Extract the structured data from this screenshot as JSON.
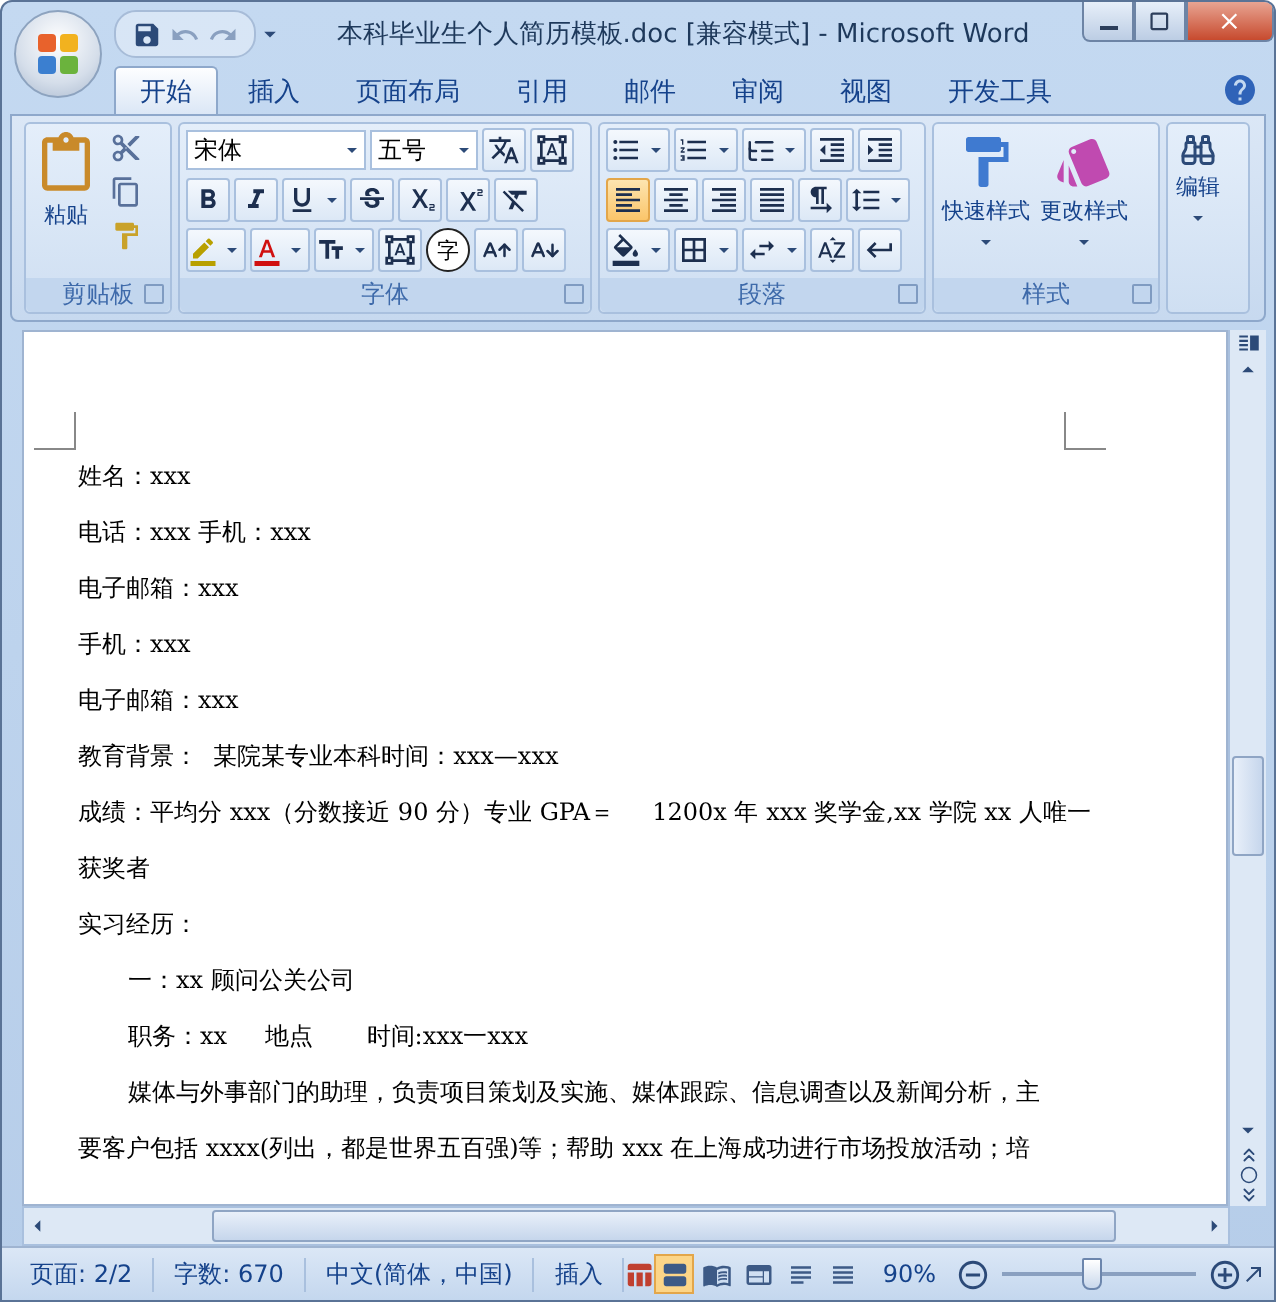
{
  "window": {
    "title": "本科毕业生个人简历模板.doc [兼容模式] - Microsoft Word"
  },
  "tabs": [
    {
      "label": "开始",
      "selected": true
    },
    {
      "label": "插入",
      "selected": false
    },
    {
      "label": "页面布局",
      "selected": false
    },
    {
      "label": "引用",
      "selected": false
    },
    {
      "label": "邮件",
      "selected": false
    },
    {
      "label": "审阅",
      "selected": false
    },
    {
      "label": "视图",
      "selected": false
    },
    {
      "label": "开发工具",
      "selected": false
    }
  ],
  "ribbon": {
    "clipboard": {
      "label": "剪贴板",
      "paste": "粘贴"
    },
    "font": {
      "label": "字体",
      "font_name": "宋体",
      "font_size": "五号",
      "enclose_char": "字"
    },
    "paragraph": {
      "label": "段落",
      "alignment": [
        {
          "selected": true
        },
        {
          "selected": false
        },
        {
          "selected": false
        },
        {
          "selected": false
        },
        {
          "selected": false
        }
      ]
    },
    "styles": {
      "label": "样式",
      "quick_styles": "快速样式",
      "change_styles": "更改样式"
    },
    "editing": {
      "button": "编辑"
    }
  },
  "document": {
    "lines": [
      {
        "text": "姓名：xxx",
        "indent": false
      },
      {
        "text": "电话：xxx 手机：xxx",
        "indent": false
      },
      {
        "text": "电子邮箱：xxx",
        "indent": false
      },
      {
        "text": "手机：xxx",
        "indent": false
      },
      {
        "text": "电子邮箱：xxx",
        "indent": false
      },
      {
        "text": "教育背景：  某院某专业本科时间：xxx—xxx",
        "indent": false
      },
      {
        "text": "成绩：平均分 xxx（分数接近 90 分）专业 GPA＝     1200x 年 xxx 奖学金,xx 学院 xx 人唯一",
        "indent": false
      },
      {
        "text": "获奖者",
        "indent": false
      },
      {
        "text": "实习经历：",
        "indent": false
      },
      {
        "text": "一：xx 顾问公关公司",
        "indent": true
      },
      {
        "text": "职务：xx     地点       时间:xxx一xxx",
        "indent": true
      },
      {
        "text": "媒体与外事部门的助理，负责项目策划及实施、媒体跟踪、信息调查以及新闻分析，主",
        "indent": true
      },
      {
        "text": "要客户包括 xxxx(列出，都是世界五百强)等；帮助 xxx 在上海成功进行市场投放活动；培",
        "indent": false
      }
    ]
  },
  "status_bar": {
    "page": "页面: 2/2",
    "words": "字数: 670",
    "language": "中文(简体，中国)",
    "mode": "插入",
    "views": [
      {
        "selected": true
      },
      {
        "selected": false
      },
      {
        "selected": false
      },
      {
        "selected": false
      },
      {
        "selected": false
      }
    ],
    "zoom": "90%",
    "zoom_slider": {
      "level": 0.45
    }
  }
}
